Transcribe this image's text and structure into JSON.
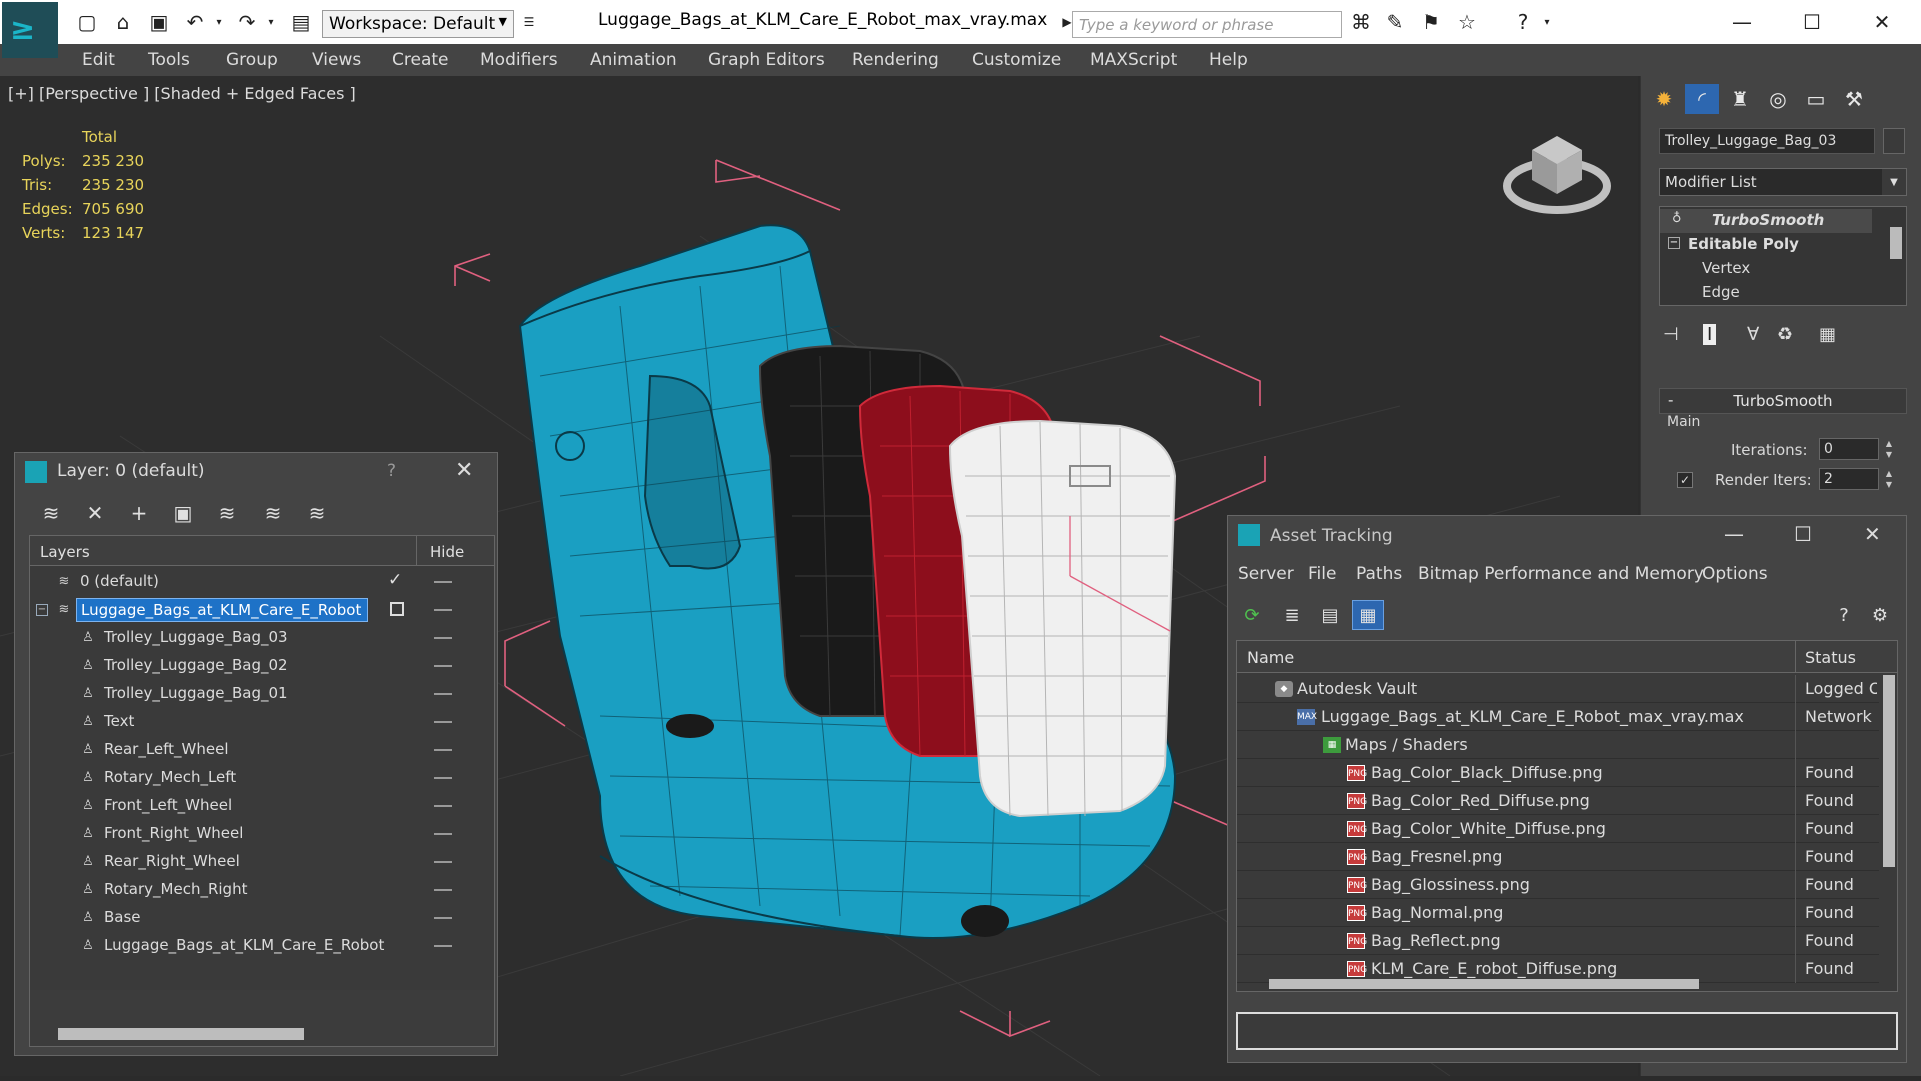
{
  "app": {
    "window_title": "Luggage_Bags_at_KLM_Care_E_Robot_max_vray.max",
    "workspace": "Workspace: Default",
    "search_placeholder": "Type a keyword or phrase"
  },
  "menu": [
    "Edit",
    "Tools",
    "Group",
    "Views",
    "Create",
    "Modifiers",
    "Animation",
    "Graph Editors",
    "Rendering",
    "Customize",
    "MAXScript",
    "Help"
  ],
  "viewport": {
    "label": "[+] [Perspective ] [Shaded + Edged Faces ]",
    "stats": {
      "header": "Total",
      "rows": [
        {
          "k": "Polys:",
          "v": "235 230"
        },
        {
          "k": "Tris:",
          "v": "235 230"
        },
        {
          "k": "Edges:",
          "v": "705 690"
        },
        {
          "k": "Verts:",
          "v": "123 147"
        }
      ]
    }
  },
  "command_panel": {
    "object_name": "Trolley_Luggage_Bag_03",
    "modifier_list": "Modifier List",
    "stack": [
      "TurboSmooth",
      "Editable Poly",
      "Vertex",
      "Edge"
    ],
    "turbosmooth": {
      "title": "TurboSmooth",
      "group": "Main",
      "iterations_label": "Iterations:",
      "iterations": "0",
      "render_iters_label": "Render Iters:",
      "render_iters": "2"
    }
  },
  "layer_panel": {
    "title": "Layer: 0 (default)",
    "help": "?",
    "col_layers": "Layers",
    "col_hide": "Hide",
    "rows": [
      {
        "name": "0 (default)"
      },
      {
        "name": "Luggage_Bags_at_KLM_Care_E_Robot"
      },
      {
        "name": "Trolley_Luggage_Bag_03"
      },
      {
        "name": "Trolley_Luggage_Bag_02"
      },
      {
        "name": "Trolley_Luggage_Bag_01"
      },
      {
        "name": "Text"
      },
      {
        "name": "Rear_Left_Wheel"
      },
      {
        "name": "Rotary_Mech_Left"
      },
      {
        "name": "Front_Left_Wheel"
      },
      {
        "name": "Front_Right_Wheel"
      },
      {
        "name": "Rear_Right_Wheel"
      },
      {
        "name": "Rotary_Mech_Right"
      },
      {
        "name": "Base"
      },
      {
        "name": "Luggage_Bags_at_KLM_Care_E_Robot"
      }
    ]
  },
  "asset_panel": {
    "title": "Asset Tracking",
    "menu": [
      "Server",
      "File",
      "Paths",
      "Bitmap Performance and Memory",
      "Options"
    ],
    "col_name": "Name",
    "col_status": "Status",
    "rows": [
      {
        "name": "Autodesk Vault",
        "status": "Logged Out"
      },
      {
        "name": "Luggage_Bags_at_KLM_Care_E_Robot_max_vray.max",
        "status": "Network Path"
      },
      {
        "name": "Maps / Shaders",
        "status": ""
      },
      {
        "name": "Bag_Color_Black_Diffuse.png",
        "status": "Found"
      },
      {
        "name": "Bag_Color_Red_Diffuse.png",
        "status": "Found"
      },
      {
        "name": "Bag_Color_White_Diffuse.png",
        "status": "Found"
      },
      {
        "name": "Bag_Fresnel.png",
        "status": "Found"
      },
      {
        "name": "Bag_Glossiness.png",
        "status": "Found"
      },
      {
        "name": "Bag_Normal.png",
        "status": "Found"
      },
      {
        "name": "Bag_Reflect.png",
        "status": "Found"
      },
      {
        "name": "KLM_Care_E_robot_Diffuse.png",
        "status": "Found"
      }
    ]
  },
  "colors": {
    "robot_body": "#1a9fc2",
    "bag_black": "#1a1a1a",
    "bag_red": "#a01020",
    "bag_white": "#f0f0f0",
    "bbox_lines": "#e0607f",
    "selection": "#1e72c7"
  }
}
